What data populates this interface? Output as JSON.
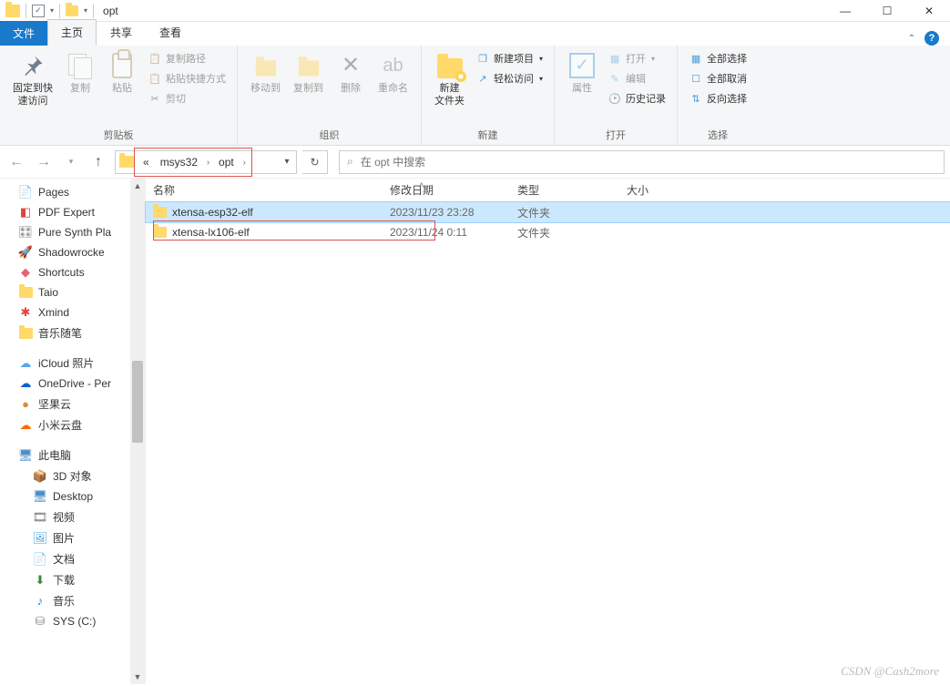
{
  "window": {
    "title": "opt"
  },
  "tabs": {
    "file": "文件",
    "home": "主页",
    "share": "共享",
    "view": "查看"
  },
  "ribbon": {
    "clipboard": {
      "label": "剪贴板",
      "pin": "固定到快\n速访问",
      "copy": "复制",
      "paste": "粘贴",
      "copypath": "复制路径",
      "pasteshortcut": "粘贴快捷方式",
      "cut": "剪切"
    },
    "organize": {
      "label": "组织",
      "moveto": "移动到",
      "copyto": "复制到",
      "delete": "删除",
      "rename": "重命名"
    },
    "new": {
      "label": "新建",
      "newfolder": "新建\n文件夹",
      "newitem": "新建项目",
      "easyaccess": "轻松访问"
    },
    "open": {
      "label": "打开",
      "properties": "属性",
      "open": "打开",
      "edit": "编辑",
      "history": "历史记录"
    },
    "select": {
      "label": "选择",
      "selectall": "全部选择",
      "selectnone": "全部取消",
      "invert": "反向选择"
    }
  },
  "breadcrumb": {
    "prefix": "«",
    "seg1": "msys32",
    "seg2": "opt"
  },
  "search": {
    "placeholder": "在 opt 中搜索"
  },
  "columns": {
    "name": "名称",
    "date": "修改日期",
    "type": "类型",
    "size": "大小"
  },
  "files": [
    {
      "name": "xtensa-esp32-elf",
      "date": "2023/11/23 23:28",
      "type": "文件夹",
      "size": ""
    },
    {
      "name": "xtensa-lx106-elf",
      "date": "2023/11/24 0:11",
      "type": "文件夹",
      "size": ""
    }
  ],
  "sidebar": [
    {
      "label": "Pages",
      "icon": "📄",
      "color": "#f5a623"
    },
    {
      "label": "PDF Expert",
      "icon": "◧",
      "color": "#e0443e"
    },
    {
      "label": "Pure Synth Pla",
      "icon": "🎛",
      "color": "#888"
    },
    {
      "label": "Shadowrocke",
      "icon": "🚀",
      "color": "#6aa0ff"
    },
    {
      "label": "Shortcuts",
      "icon": "◆",
      "color": "#f25c78"
    },
    {
      "label": "Taio",
      "icon": "folder",
      "color": ""
    },
    {
      "label": "Xmind",
      "icon": "✱",
      "color": "#e0443e"
    },
    {
      "label": "音乐随笔",
      "icon": "folder",
      "color": ""
    },
    {
      "label": "",
      "icon": "",
      "spacer": true
    },
    {
      "label": "iCloud 照片",
      "icon": "☁",
      "color": "#5aa7e8"
    },
    {
      "label": "OneDrive - Per",
      "icon": "☁",
      "color": "#0a62c9"
    },
    {
      "label": "坚果云",
      "icon": "●",
      "color": "#d98c3a"
    },
    {
      "label": "小米云盘",
      "icon": "☁",
      "color": "#ff6a00"
    },
    {
      "label": "",
      "icon": "",
      "spacer": true
    },
    {
      "label": "此电脑",
      "icon": "🖥",
      "color": "#4a8ec9"
    },
    {
      "label": "3D 对象",
      "icon": "📦",
      "color": "#5aa7e8",
      "lvl": 2
    },
    {
      "label": "Desktop",
      "icon": "🖥",
      "color": "#4a8ec9",
      "lvl": 2
    },
    {
      "label": "视频",
      "icon": "🎞",
      "color": "#777",
      "lvl": 2
    },
    {
      "label": "图片",
      "icon": "🖼",
      "color": "#4aa0e0",
      "lvl": 2
    },
    {
      "label": "文档",
      "icon": "📄",
      "color": "#777",
      "lvl": 2
    },
    {
      "label": "下载",
      "icon": "⬇",
      "color": "#3a8a3a",
      "lvl": 2
    },
    {
      "label": "音乐",
      "icon": "♪",
      "color": "#2288dd",
      "lvl": 2
    },
    {
      "label": "SYS (C:)",
      "icon": "⛁",
      "color": "#888",
      "lvl": 2
    }
  ],
  "watermark": "CSDN @Cash2more"
}
